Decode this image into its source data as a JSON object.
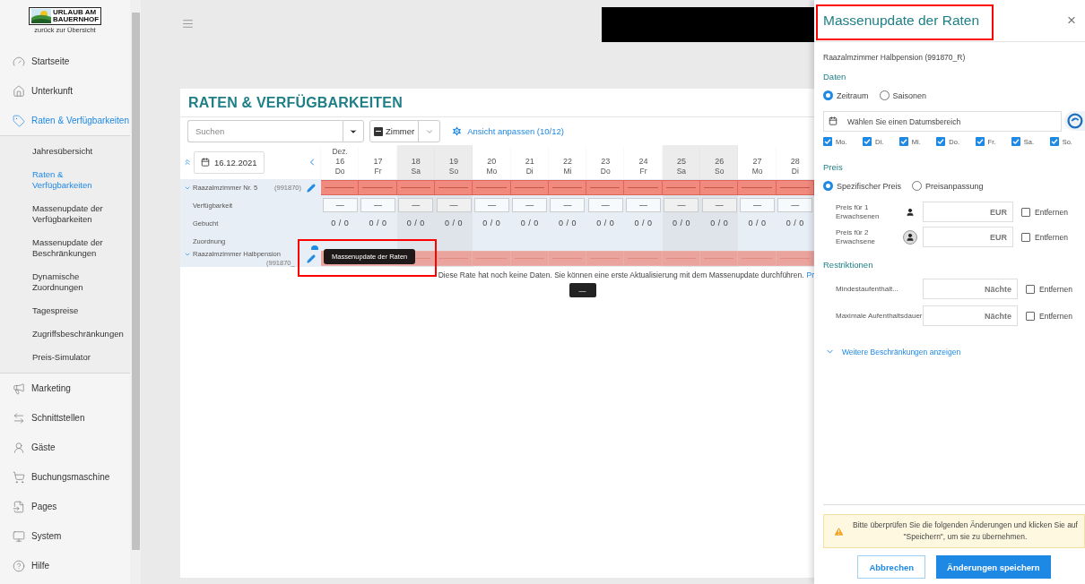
{
  "sidebar": {
    "logo": {
      "line_1": "URLAUB AM",
      "line_2": "BAUERNHOF",
      "back_link": "zurück zur Übersicht"
    },
    "items": [
      {
        "label": "Startseite",
        "selected": false
      },
      {
        "label": "Unterkunft",
        "selected": false
      },
      {
        "label": "Raten & Verfügbarkeiten",
        "selected": true,
        "expanded": true,
        "children": [
          {
            "label": "Jahresübersicht",
            "selected": false
          },
          {
            "label": "Raten & Verfügbarkeiten",
            "selected": true
          },
          {
            "label": "Massenupdate der Verfügbarkeiten",
            "selected": false
          },
          {
            "label": "Massenupdate der Beschränkungen",
            "selected": false
          },
          {
            "label": "Dynamische Zuordnungen",
            "selected": false
          },
          {
            "label": "Tagespreise",
            "selected": false
          },
          {
            "label": "Zugriffsbeschränkungen",
            "selected": false
          },
          {
            "label": "Preis-Simulator",
            "selected": false
          }
        ]
      },
      {
        "label": "Marketing",
        "selected": false
      },
      {
        "label": "Schnittstellen",
        "selected": false
      },
      {
        "label": "Gäste",
        "selected": false
      },
      {
        "label": "Buchungsmaschine",
        "selected": false
      },
      {
        "label": "Pages",
        "selected": false
      },
      {
        "label": "System",
        "selected": false
      },
      {
        "label": "Hilfe",
        "selected": false
      }
    ]
  },
  "main": {
    "page_title": "RATEN & VERFÜGBARKEITEN",
    "search": {
      "placeholder": "Suchen"
    },
    "room_filter": "Zimmer",
    "view_link": "Ansicht anpassen (10/12)",
    "start_date": "16.12.2021",
    "month": "Dez.",
    "days": [
      {
        "day": "16",
        "weekday": "Do",
        "weekend": false,
        "availability": "—",
        "booked": "0 / 0"
      },
      {
        "day": "17",
        "weekday": "Fr",
        "weekend": false,
        "availability": "—",
        "booked": "0 / 0"
      },
      {
        "day": "18",
        "weekday": "Sa",
        "weekend": true,
        "availability": "—",
        "booked": "0 / 0"
      },
      {
        "day": "19",
        "weekday": "So",
        "weekend": true,
        "availability": "—",
        "booked": "0 / 0"
      },
      {
        "day": "20",
        "weekday": "Mo",
        "weekend": false,
        "availability": "—",
        "booked": "0 / 0"
      },
      {
        "day": "21",
        "weekday": "Di",
        "weekend": false,
        "availability": "—",
        "booked": "0 / 0"
      },
      {
        "day": "22",
        "weekday": "Mi",
        "weekend": false,
        "availability": "—",
        "booked": "0 / 0"
      },
      {
        "day": "23",
        "weekday": "Do",
        "weekend": false,
        "availability": "—",
        "booked": "0 / 0"
      },
      {
        "day": "24",
        "weekday": "Fr",
        "weekend": false,
        "availability": "—",
        "booked": "0 / 0"
      },
      {
        "day": "25",
        "weekday": "Sa",
        "weekend": true,
        "availability": "—",
        "booked": "0 / 0"
      },
      {
        "day": "26",
        "weekday": "So",
        "weekend": true,
        "availability": "—",
        "booked": "0 / 0"
      },
      {
        "day": "27",
        "weekday": "Mo",
        "weekend": false,
        "availability": "—",
        "booked": "0 / 0"
      },
      {
        "day": "28",
        "weekday": "Di",
        "weekend": false,
        "availability": "—",
        "booked": "0 / 0"
      }
    ],
    "room": {
      "name": "Raazalmzimmer Nr. 5",
      "code": "(991870)",
      "expanded": true,
      "rows": [
        {
          "label": "Verfügbarkeit",
          "kind": "availability"
        },
        {
          "label": "Gebucht",
          "kind": "booked"
        },
        {
          "label": "Zuordnung",
          "kind": "assignment"
        }
      ]
    },
    "rate": {
      "name": "Raazalmzimmer Halbpension",
      "code": "(991870_",
      "expanded": true
    },
    "tooltip": "Massenupdate der Raten",
    "empty_message": "Diese Rate hat noch keine Daten. Sie können eine erste Aktualisierung mit dem Massenupdate durchführen.",
    "empty_link": "Pr",
    "empty_button": "—"
  },
  "panel": {
    "title": "Massenupdate der Raten",
    "close": "×",
    "subject": "Raazalmzimmer Halbpension (991870_R)",
    "dates_heading": "Daten",
    "date_modes": [
      {
        "label": "Zeitraum",
        "selected": true
      },
      {
        "label": "Saisonen",
        "selected": false
      }
    ],
    "date_range": {
      "placeholder": "Wählen Sie einen Datumsbereich"
    },
    "weekdays": [
      {
        "label": "Mo.",
        "checked": true
      },
      {
        "label": "Di.",
        "checked": true
      },
      {
        "label": "Mi.",
        "checked": true
      },
      {
        "label": "Do.",
        "checked": true
      },
      {
        "label": "Fr.",
        "checked": true
      },
      {
        "label": "Sa.",
        "checked": true
      },
      {
        "label": "So.",
        "checked": true
      }
    ],
    "price_heading": "Preis",
    "price_modes": [
      {
        "label": "Spezifischer Preis",
        "selected": true
      },
      {
        "label": "Preisanpassung",
        "selected": false
      }
    ],
    "prices": [
      {
        "label": "Preis für 1 Erwachsenen",
        "placeholder": "EUR",
        "remove": "Entfernen",
        "checked": false
      },
      {
        "label": "Preis für 2 Erwachsene",
        "placeholder": "EUR",
        "remove": "Entfernen",
        "checked": false
      }
    ],
    "restrictions_heading": "Restriktionen",
    "restrictions": [
      {
        "label": "Mindestaufenthalt...",
        "placeholder": "Nächte",
        "remove": "Entfernen",
        "checked": false
      },
      {
        "label": "Maximale Aufenthaltsdauer",
        "placeholder": "Nächte",
        "remove": "Entfernen",
        "checked": false
      }
    ],
    "more_link": "Weitere Beschränkungen anzeigen",
    "warning": "Bitte überprüfen Sie die folgenden Änderungen und klicken Sie auf \"Speichern\", um sie zu übernehmen.",
    "cancel": "Abbrechen",
    "save": "Änderungen speichern"
  }
}
